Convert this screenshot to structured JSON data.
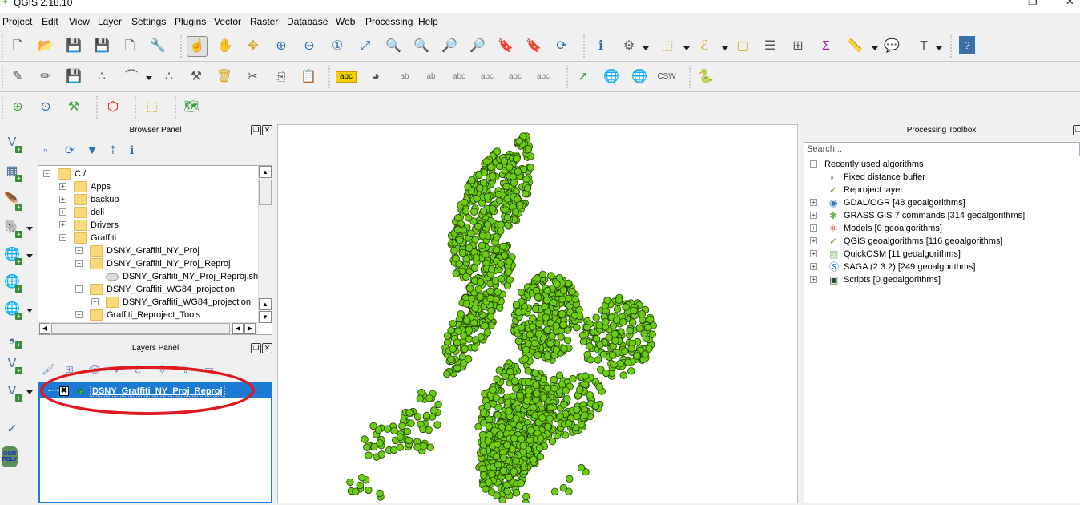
{
  "window": {
    "title": "QGIS 2.18.10",
    "controls": {
      "minimize": "—",
      "maximize": "❐",
      "close": "✕"
    }
  },
  "menu": [
    "Project",
    "Edit",
    "View",
    "Layer",
    "Settings",
    "Plugins",
    "Vector",
    "Raster",
    "Database",
    "Web",
    "Processing",
    "Help"
  ],
  "toolbar1": [
    {
      "name": "new-project-icon",
      "glyph": "🗋"
    },
    {
      "name": "open-project-icon",
      "glyph": "📂"
    },
    {
      "name": "save-project-icon",
      "glyph": "💾"
    },
    {
      "name": "save-as-icon",
      "glyph": "💾"
    },
    {
      "name": "new-print-composer-icon",
      "glyph": "🗋"
    },
    {
      "name": "composer-manager-icon",
      "glyph": "🔧"
    },
    {
      "name": "touch-zoom-pan-icon",
      "glyph": "☝"
    },
    {
      "name": "pan-map-icon",
      "glyph": "✋"
    },
    {
      "name": "pan-to-selection-icon",
      "glyph": "✥"
    },
    {
      "name": "zoom-in-icon",
      "glyph": "⊕"
    },
    {
      "name": "zoom-out-icon",
      "glyph": "⊖"
    },
    {
      "name": "zoom-native-icon",
      "glyph": "①"
    },
    {
      "name": "zoom-full-icon",
      "glyph": "⤢"
    },
    {
      "name": "zoom-to-selection-icon",
      "glyph": "🔍"
    },
    {
      "name": "zoom-to-layer-icon",
      "glyph": "🔍"
    },
    {
      "name": "zoom-last-icon",
      "glyph": "🔎"
    },
    {
      "name": "zoom-next-icon",
      "glyph": "🔎"
    },
    {
      "name": "new-bookmark-icon",
      "glyph": "🔖"
    },
    {
      "name": "show-bookmarks-icon",
      "glyph": "🔖"
    },
    {
      "name": "refresh-icon",
      "glyph": "⟳"
    },
    {
      "name": "identify-features-icon",
      "glyph": "ℹ"
    },
    {
      "name": "run-feature-action-icon",
      "glyph": "⚙"
    },
    {
      "name": "select-features-icon",
      "glyph": "⬚"
    },
    {
      "name": "select-by-expression-icon",
      "glyph": "ℰ"
    },
    {
      "name": "deselect-features-icon",
      "glyph": "▢"
    },
    {
      "name": "attribute-table-icon",
      "glyph": "☰"
    },
    {
      "name": "field-calculator-icon",
      "glyph": "⊞"
    },
    {
      "name": "statistical-summary-icon",
      "glyph": "Σ"
    },
    {
      "name": "measure-line-icon",
      "glyph": "📏"
    },
    {
      "name": "map-tips-icon",
      "glyph": "💬"
    },
    {
      "name": "text-annotation-icon",
      "glyph": "T"
    },
    {
      "name": "help-icon",
      "glyph": "?"
    }
  ],
  "toolbar2": [
    {
      "name": "current-edits-icon",
      "glyph": "✎"
    },
    {
      "name": "toggle-editing-icon",
      "glyph": "✏"
    },
    {
      "name": "save-layer-edits-icon",
      "glyph": "💾"
    },
    {
      "name": "add-feature-icon",
      "glyph": "∴"
    },
    {
      "name": "node-tool-icon",
      "glyph": "⌒"
    },
    {
      "name": "move-feature-icon",
      "glyph": "∴"
    },
    {
      "name": "node-tool-alt-icon",
      "glyph": "⚒"
    },
    {
      "name": "delete-selected-icon",
      "glyph": "🗑"
    },
    {
      "name": "cut-features-icon",
      "glyph": "✂"
    },
    {
      "name": "copy-features-icon",
      "glyph": "⎘"
    },
    {
      "name": "paste-features-icon",
      "glyph": "📋"
    },
    {
      "name": "layer-labeling-icon",
      "glyph": "abc"
    },
    {
      "name": "layer-diagram-icon",
      "glyph": "◕"
    },
    {
      "name": "highlight-pinned-labels-icon",
      "glyph": "ab"
    },
    {
      "name": "pin-labels-icon",
      "glyph": "ab"
    },
    {
      "name": "show-hide-labels-icon",
      "glyph": "abc"
    },
    {
      "name": "move-label-icon",
      "glyph": "abc"
    },
    {
      "name": "rotate-label-icon",
      "glyph": "abc"
    },
    {
      "name": "change-label-icon",
      "glyph": "abc"
    },
    {
      "name": "quickosm-icon",
      "glyph": "➚"
    },
    {
      "name": "metasearch-add-icon",
      "glyph": "🌐"
    },
    {
      "name": "metasearch-search-icon",
      "glyph": "🌐"
    },
    {
      "name": "csw-icon",
      "glyph": "CSW"
    },
    {
      "name": "python-console-icon",
      "glyph": "🐍"
    }
  ],
  "toolbar3": [
    {
      "name": "add-gps-layer-icon",
      "glyph": "⊕"
    },
    {
      "name": "gps-refresh-icon",
      "glyph": "⊙"
    },
    {
      "name": "gps-tool-icon",
      "glyph": "⚒"
    },
    {
      "name": "add-circular-string-icon",
      "glyph": "⬡"
    },
    {
      "name": "select-by-location-icon",
      "glyph": "⬚"
    },
    {
      "name": "quickosm-query-icon",
      "glyph": "🗺"
    }
  ],
  "left_toolbar": [
    {
      "name": "add-vector-layer-icon",
      "glyph": "V",
      "dropdown": false
    },
    {
      "name": "add-raster-layer-icon",
      "glyph": "▦",
      "dropdown": false
    },
    {
      "name": "add-spatialite-layer-icon",
      "glyph": "🪶",
      "dropdown": false
    },
    {
      "name": "add-postgis-layer-icon",
      "glyph": "🐘",
      "dropdown": true
    },
    {
      "name": "add-wms-layer-icon",
      "glyph": "🌐",
      "dropdown": true
    },
    {
      "name": "add-wcs-layer-icon",
      "glyph": "🌐",
      "dropdown": false
    },
    {
      "name": "add-wfs-layer-icon",
      "glyph": "🌐",
      "dropdown": true
    },
    {
      "name": "add-delimited-text-icon",
      "glyph": "❟",
      "dropdown": false
    },
    {
      "name": "add-virtual-layer-icon",
      "glyph": "V",
      "dropdown": false
    },
    {
      "name": "new-shapefile-layer-icon",
      "glyph": "V",
      "dropdown": true
    },
    {
      "name": "topology-checker-icon",
      "glyph": "✓",
      "dropdown": false
    },
    {
      "name": "osm-poly-icon",
      "glyph": "OSM POLY",
      "dropdown": false
    }
  ],
  "browser": {
    "title": "Browser Panel",
    "tools": [
      "add-selected-layers-icon",
      "refresh-icon",
      "filter-icon",
      "collapse-all-icon",
      "properties-icon"
    ],
    "tree": [
      {
        "label": "C:/",
        "level": 0,
        "expander": "minus",
        "type": "folder"
      },
      {
        "label": "Apps",
        "level": 1,
        "expander": "plus",
        "type": "folder"
      },
      {
        "label": "backup",
        "level": 1,
        "expander": "plus",
        "type": "folder"
      },
      {
        "label": "dell",
        "level": 1,
        "expander": "plus",
        "type": "folder"
      },
      {
        "label": "Drivers",
        "level": 1,
        "expander": "plus",
        "type": "folder"
      },
      {
        "label": "Graffiti",
        "level": 1,
        "expander": "minus",
        "type": "folder"
      },
      {
        "label": "DSNY_Graffiti_NY_Proj",
        "level": 2,
        "expander": "plus",
        "type": "folder"
      },
      {
        "label": "DSNY_Graffiti_NY_Proj_Reproj",
        "level": 2,
        "expander": "minus",
        "type": "folder"
      },
      {
        "label": "DSNY_Graffiti_NY_Proj_Reproj.shp",
        "level": 3,
        "expander": "none",
        "type": "shapefile"
      },
      {
        "label": "DSNY_Graffiti_WG84_projection",
        "level": 2,
        "expander": "minus",
        "type": "folder"
      },
      {
        "label": "DSNY_Graffiti_WG84_projection",
        "level": 3,
        "expander": "plus",
        "type": "folder"
      },
      {
        "label": "Graffiti_Reproject_Tools",
        "level": 2,
        "expander": "plus",
        "type": "folder"
      }
    ]
  },
  "layers": {
    "title": "Layers Panel",
    "tools": [
      "style-manager-icon",
      "add-group-icon",
      "manage-visibility-icon",
      "filter-legend-icon",
      "filter-expression-icon",
      "expand-all-icon",
      "collapse-all-icon",
      "remove-layer-icon"
    ],
    "items": [
      {
        "label": "DSNY_Graffiti_NY_Proj_Reproj",
        "checked": true,
        "selected": true,
        "symbol_color": "#3fae3a"
      }
    ]
  },
  "map": {
    "point_fill": "#6ccc14",
    "point_stroke": "#1e3d00",
    "layer": "DSNY_Graffiti_NY_Proj_Reproj"
  },
  "processing": {
    "title": "Processing Toolbox",
    "search_placeholder": "Search...",
    "tree": [
      {
        "label": "Recently used algorithms",
        "level": 0,
        "expander": "minus",
        "icon": ""
      },
      {
        "label": "Fixed distance buffer",
        "level": 1,
        "expander": "none",
        "icon": "buffer-icon"
      },
      {
        "label": "Reproject layer",
        "level": 1,
        "expander": "none",
        "icon": "qgis-algorithm-icon"
      },
      {
        "label": "GDAL/OGR [48 geoalgorithms]",
        "level": 0,
        "expander": "plus",
        "icon": "gdal-icon"
      },
      {
        "label": "GRASS GIS 7 commands [314 geoalgorithms]",
        "level": 0,
        "expander": "plus",
        "icon": "grass-icon"
      },
      {
        "label": "Models [0 geoalgorithms]",
        "level": 0,
        "expander": "plus",
        "icon": "models-icon"
      },
      {
        "label": "QGIS geoalgorithms [116 geoalgorithms]",
        "level": 0,
        "expander": "plus",
        "icon": "qgis-algorithm-icon"
      },
      {
        "label": "QuickOSM [11 geoalgorithms]",
        "level": 0,
        "expander": "plus",
        "icon": "quickosm-icon"
      },
      {
        "label": "SAGA (2.3.2) [249 geoalgorithms]",
        "level": 0,
        "expander": "plus",
        "icon": "saga-icon"
      },
      {
        "label": "Scripts [0 geoalgorithms]",
        "level": 0,
        "expander": "plus",
        "icon": "scripts-icon"
      }
    ]
  },
  "annotation": {
    "color": "#e3171f"
  },
  "colors": {
    "selection": "#1b7bd4",
    "folder": "#fbd97a"
  }
}
